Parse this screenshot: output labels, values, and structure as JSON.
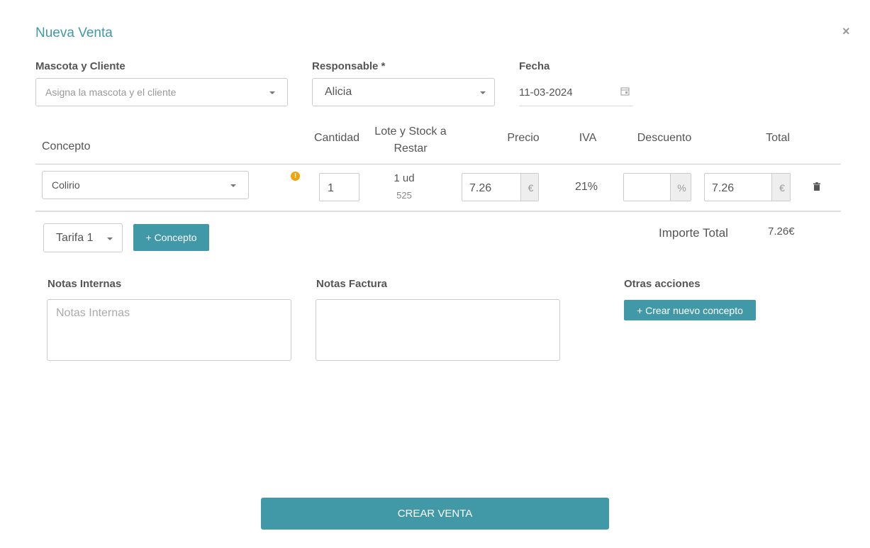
{
  "modal": {
    "title": "Nueva Venta",
    "close_label": "×"
  },
  "fields": {
    "client_label": "Mascota y Cliente",
    "client_placeholder": "Asigna la mascota y el cliente",
    "responsible_label": "Responsable *",
    "responsible_value": "Alicia",
    "date_label": "Fecha",
    "date_value": "11-03-2024"
  },
  "table": {
    "headers": {
      "concept": "Concepto",
      "quantity": "Cantidad",
      "lot_line1": "Lote y Stock a",
      "lot_line2": "Restar",
      "price": "Precio",
      "vat": "IVA",
      "discount": "Descuento",
      "total": "Total"
    },
    "row": {
      "concept": "Colirio",
      "warning_icon": "!",
      "quantity": "1",
      "stock_units": "1 ud",
      "stock_count": "525",
      "price": "7.26",
      "price_currency": "€",
      "vat": "21%",
      "discount": "",
      "discount_unit": "%",
      "total": "7.26",
      "total_currency": "€"
    }
  },
  "footer": {
    "tariff": "Tarifa 1",
    "add_concept": "+ Concepto",
    "total_label": "Importe Total",
    "total_value": "7.26€"
  },
  "notes": {
    "internal_label": "Notas Internas",
    "internal_placeholder": "Notas Internas",
    "invoice_label": "Notas Factura",
    "other_label": "Otras acciones",
    "create_concept": "+ Crear nuevo concepto"
  },
  "submit": {
    "label": "CREAR VENTA"
  },
  "colors": {
    "accent": "#4199a8",
    "warning": "#f0a30a"
  }
}
